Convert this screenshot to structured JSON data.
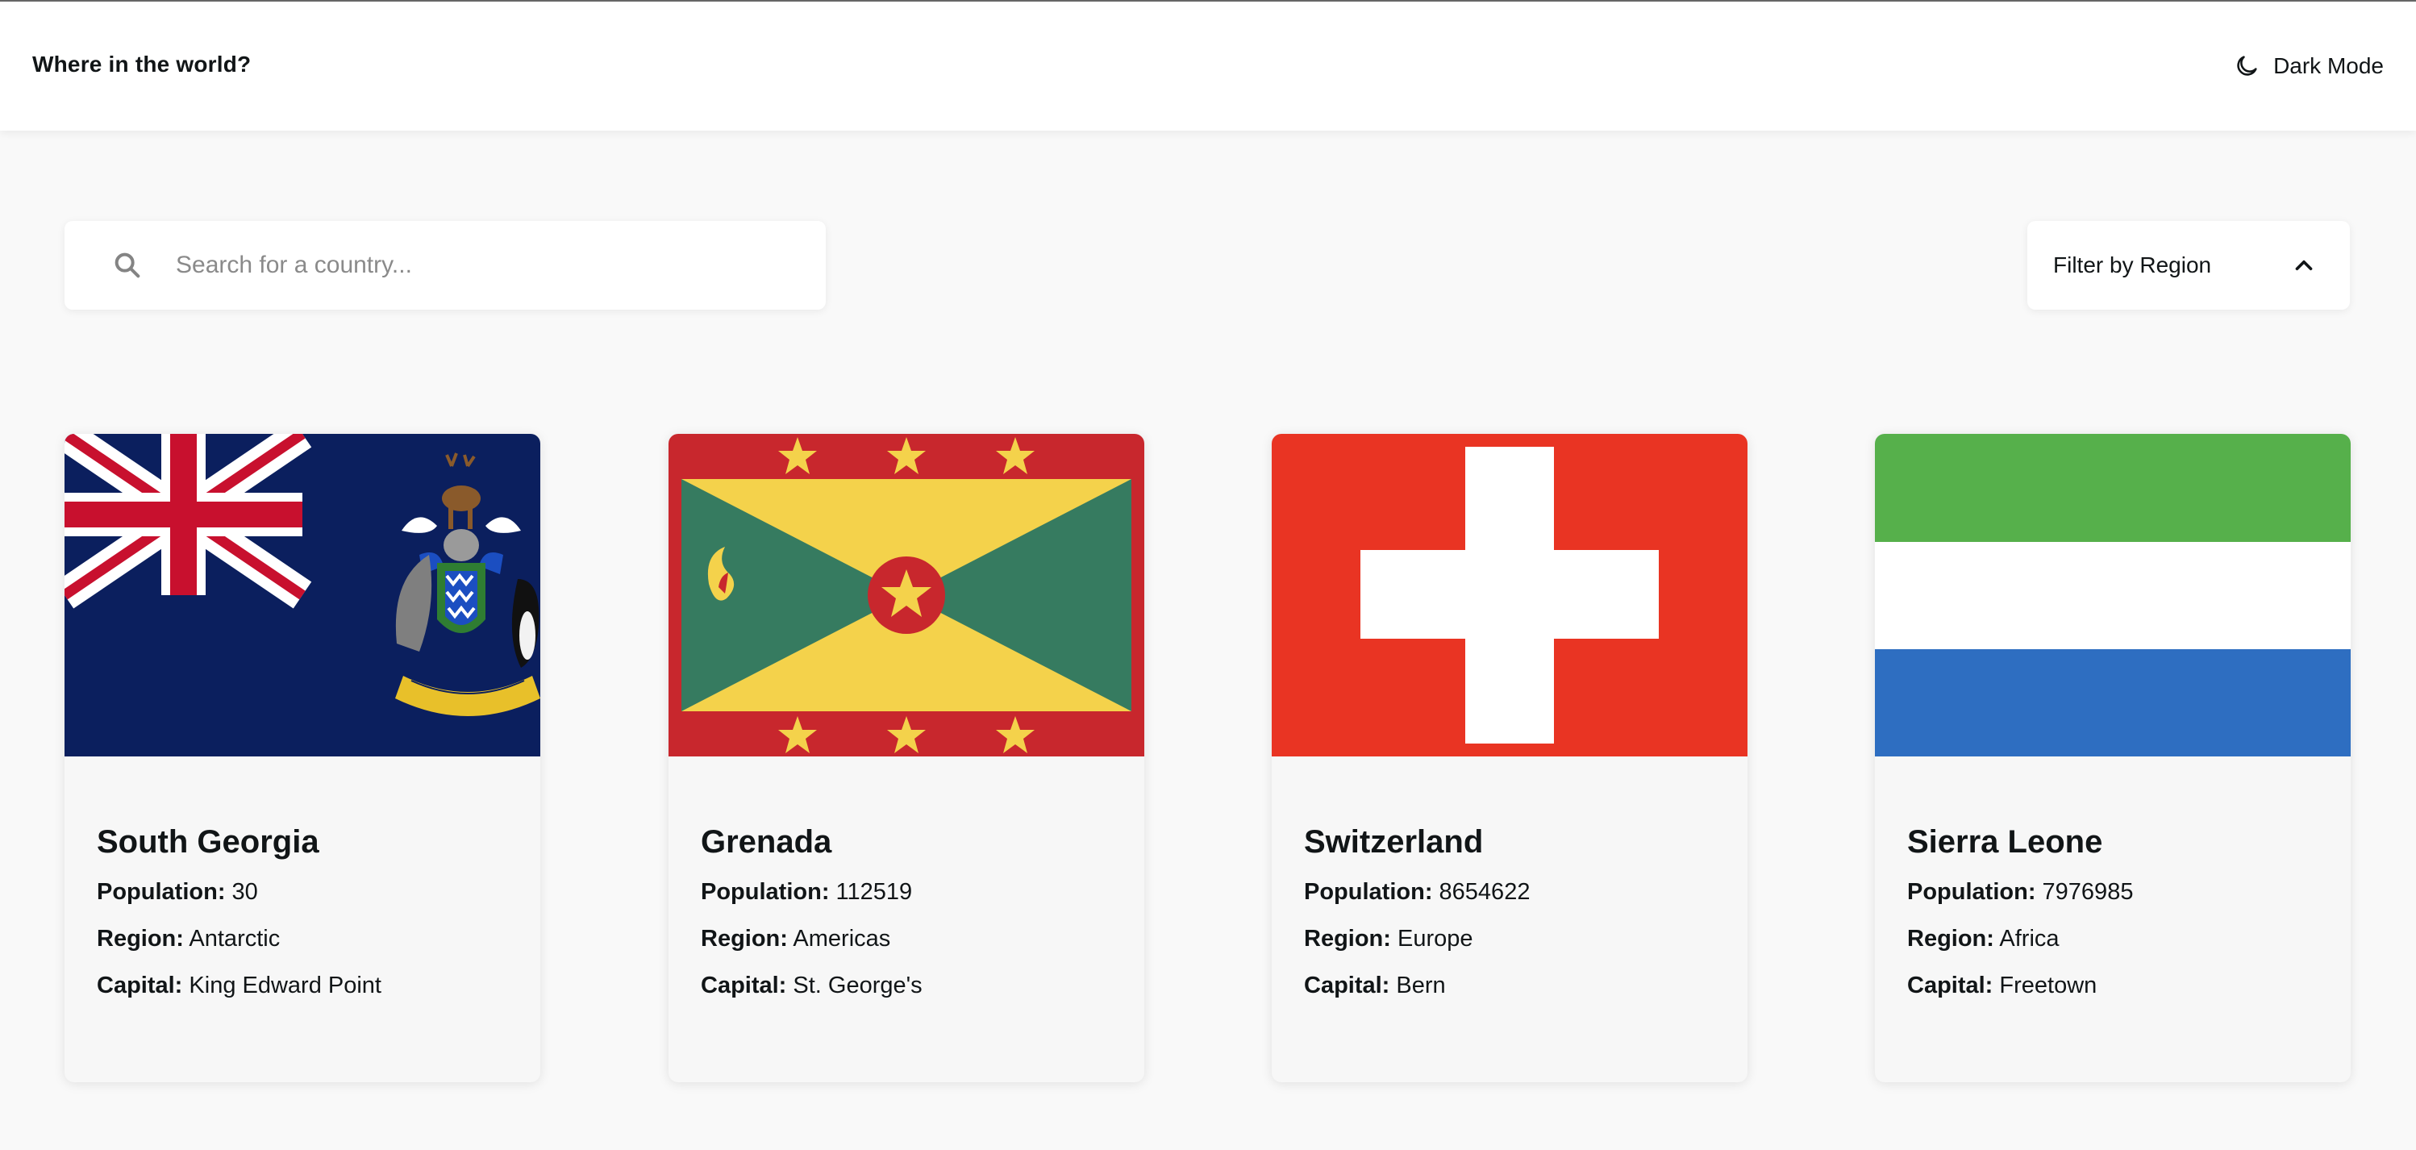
{
  "header": {
    "title": "Where in the world?",
    "mode_label": "Dark Mode",
    "mode_icon": "moon-icon"
  },
  "search": {
    "placeholder": "Search for a country...",
    "value": "",
    "icon": "search-icon"
  },
  "filter": {
    "label": "Filter by Region",
    "icon": "chevron-up-icon"
  },
  "labels": {
    "population": "Population:",
    "region": "Region:",
    "capital": "Capital:"
  },
  "countries": [
    {
      "name": "South Georgia",
      "population": "30",
      "region": "Antarctic",
      "capital": "King Edward Point",
      "flag": "flag-south-georgia"
    },
    {
      "name": "Grenada",
      "population": "112519",
      "region": "Americas",
      "capital": "St. George's",
      "flag": "flag-grenada"
    },
    {
      "name": "Switzerland",
      "population": "8654622",
      "region": "Europe",
      "capital": "Bern",
      "flag": "flag-switzerland"
    },
    {
      "name": "Sierra Leone",
      "population": "7976985",
      "region": "Africa",
      "capital": "Freetown",
      "flag": "flag-sierra-leone"
    }
  ],
  "colors": {
    "page_bg": "#f9f9f9",
    "element_bg": "#ffffff",
    "text": "#111517",
    "placeholder": "#8a8a8a"
  }
}
